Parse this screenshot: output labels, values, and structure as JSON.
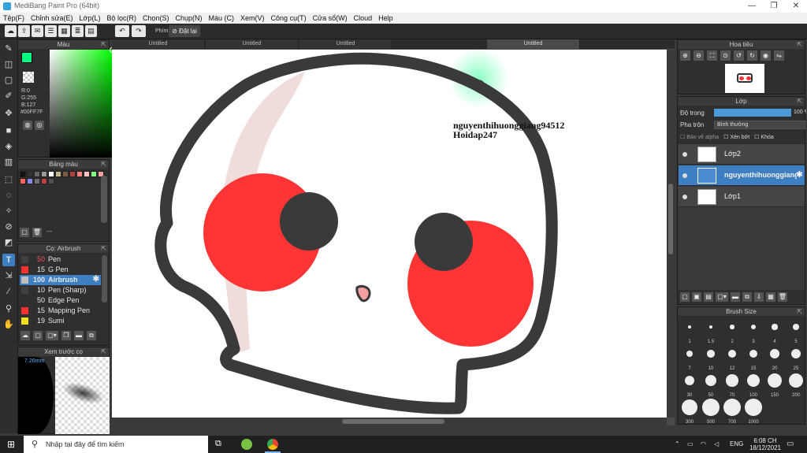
{
  "window": {
    "title": "MediBang Paint Pro (64bit)",
    "minimize": "—",
    "maximize": "❐",
    "close": "✕"
  },
  "menu": [
    "Tệp(F)",
    "Chỉnh sửa(E)",
    "Lớp(L)",
    "Bộ lọc(R)",
    "Chọn(S)",
    "Chụp(N)",
    "Màu (C)",
    "Xem(V)",
    "Công cụ(T)",
    "Cửa sổ(W)",
    "Cloud",
    "Help"
  ],
  "toolbar": {
    "key_label": "Phím",
    "reset_label": "Đặt lại"
  },
  "color_panel": {
    "title": "Màu",
    "r": "R:0",
    "g": "G:255",
    "b": "B:127",
    "hex": "#00FF7F",
    "fg_color": "#00FF7F"
  },
  "palette_panel": {
    "title": "Bảng màu",
    "status": "---",
    "swatches": [
      "#111111",
      "#333333",
      "#666666",
      "#999999",
      "#ffffff",
      "#c8b890",
      "#7a5a40",
      "#b04040",
      "#ff8080",
      "#ffc0c0",
      "#80ff80",
      "#ffa0a0",
      "#ff6060",
      "#8888ff",
      "#707070",
      "#c04040",
      "#505050"
    ]
  },
  "brush_panel": {
    "title": "Cọ: Airbrush",
    "brushes": [
      {
        "size": "50",
        "name": "Pen",
        "color": "#404040"
      },
      {
        "size": "15",
        "name": "G Pen",
        "color": "#ff3030"
      },
      {
        "size": "100",
        "name": "Airbrush",
        "color": "#c0c0c0"
      },
      {
        "size": "10",
        "name": "Pen (Sharp)",
        "color": "#404040"
      },
      {
        "size": "50",
        "name": "Edge Pen",
        "color": "#303030"
      },
      {
        "size": "15",
        "name": "Mapping Pen",
        "color": "#ff3030"
      },
      {
        "size": "19",
        "name": "Sumi",
        "color": "#f0e020"
      }
    ]
  },
  "preview_panel": {
    "title": "Xem trước cọ",
    "size": "7.26mm"
  },
  "tabs": [
    "Untitled",
    "Untitled",
    "Untitled",
    "Untitled"
  ],
  "canvas": {
    "text_line1": "nguyenthihuonggiang94512",
    "text_line2": "Hoidap247"
  },
  "navigator_panel": {
    "title": "Hoa tiêu"
  },
  "layer_panel": {
    "title": "Lớp",
    "opacity_label": "Độ trong",
    "opacity_value": "100 %",
    "blend_label": "Pha trộn",
    "blend_value": "Bình thường",
    "protect_alpha": "Bảo vệ alpha",
    "clipping": "Xén bớt",
    "lock": "Khóa",
    "layers": [
      "Lớp2",
      "nguyenthihuonggiang",
      "Lớp1"
    ]
  },
  "brush_size_panel": {
    "title": "Brush Size",
    "sizes": [
      "1",
      "1.5",
      "2",
      "3",
      "4",
      "5",
      "7",
      "10",
      "12",
      "15",
      "20",
      "25",
      "30",
      "50",
      "70",
      "100",
      "150",
      "200",
      "300",
      "500",
      "700",
      "1000"
    ]
  },
  "taskbar": {
    "search_placeholder": "Nhập tại đây để tìm kiếm",
    "lang": "ENG",
    "time": "6:08 CH",
    "date": "18/12/2021"
  }
}
